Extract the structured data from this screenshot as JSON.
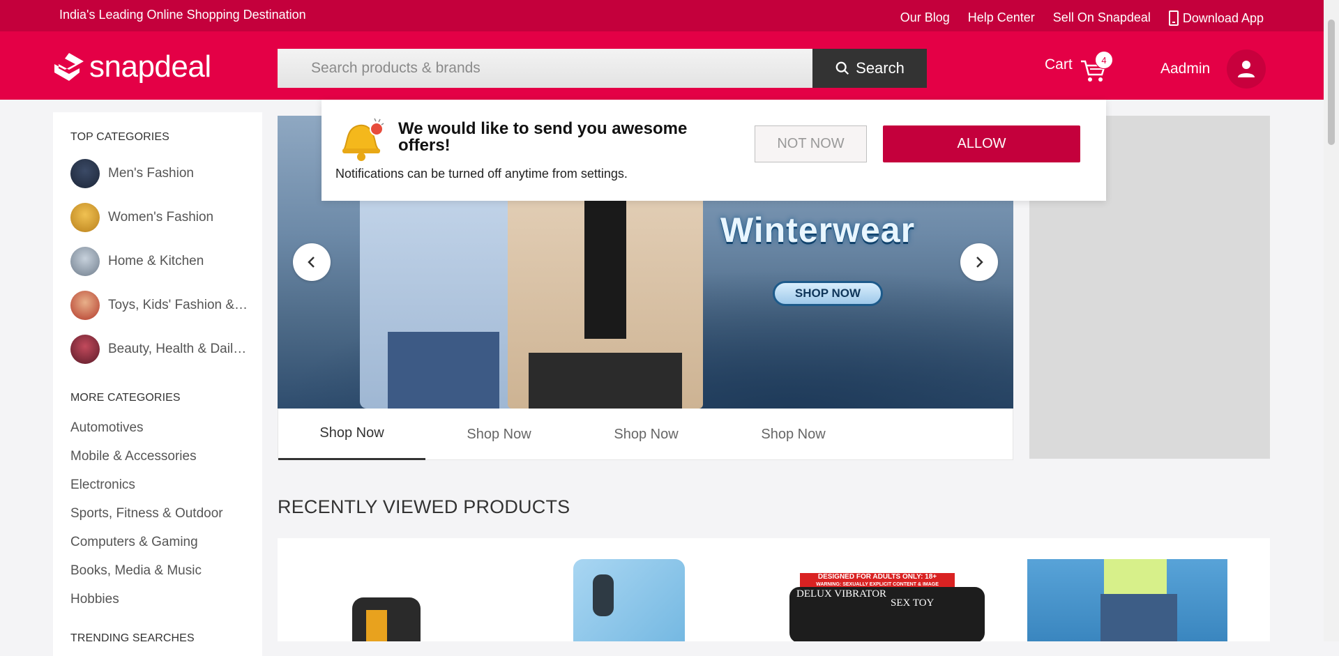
{
  "topbar": {
    "tagline": "India's Leading Online Shopping Destination",
    "links": [
      "Our Blog",
      "Help Center",
      "Sell On Snapdeal"
    ],
    "download_label": "Download App"
  },
  "header": {
    "logo_text": "snapdeal",
    "search": {
      "placeholder": "Search products & brands",
      "button_label": "Search"
    },
    "cart": {
      "label": "Cart",
      "count": "4"
    },
    "user": {
      "name": "Aadmin"
    }
  },
  "sidebar": {
    "top_title": "TOP CATEGORIES",
    "top_categories": [
      {
        "label": "Men's Fashion",
        "color": "#2a3a55"
      },
      {
        "label": "Women's Fashion",
        "color": "#d9a12a"
      },
      {
        "label": "Home & Kitchen",
        "color": "#9aa7b5"
      },
      {
        "label": "Toys, Kids' Fashion & m...",
        "color": "#c94a3a"
      },
      {
        "label": "Beauty, Health & Daily ...",
        "color": "#8a2a3a"
      }
    ],
    "more_title": "MORE CATEGORIES",
    "more_categories": [
      "Automotives",
      "Mobile & Accessories",
      "Electronics",
      "Sports, Fitness & Outdoor",
      "Computers & Gaming",
      "Books, Media & Music",
      "Hobbies"
    ],
    "trending_title": "TRENDING SEARCHES"
  },
  "banner": {
    "headline": "Winterwear",
    "cta": "SHOP NOW",
    "tabs": [
      "Shop Now",
      "Shop Now",
      "Shop Now",
      "Shop Now"
    ],
    "active_tab": 0
  },
  "recently_viewed": {
    "title": "RECENTLY VIEWED PRODUCTS",
    "adult_label_1": "DESIGNED FOR ADULTS ONLY: 18+",
    "adult_label_2": "WARNING: SEXUALLY EXPLICIT CONTENT & IMAGE",
    "product_box_text_1": "DELUX VIBRATOR",
    "product_box_text_2": "SEX TOY"
  },
  "notification": {
    "title": "We would like to send you awesome offers!",
    "subtitle": "Notifications can be turned off anytime from settings.",
    "not_now": "NOT NOW",
    "allow": "ALLOW"
  },
  "colors": {
    "brand_dark": "#c4003c",
    "brand": "#e40046"
  }
}
